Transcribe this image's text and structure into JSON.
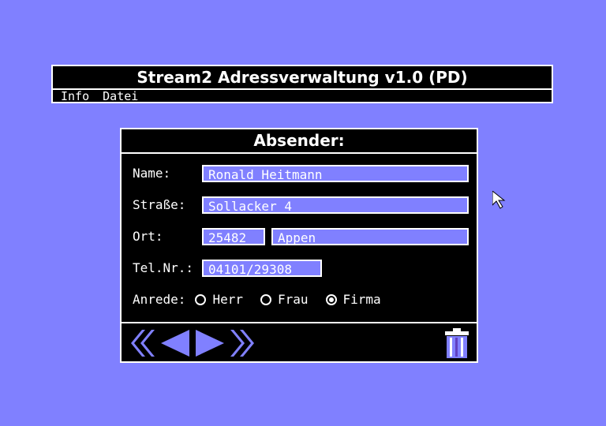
{
  "app": {
    "title": "Stream2 Adressverwaltung v1.0 (PD)",
    "menu": [
      {
        "label": "Info"
      },
      {
        "label": "Datei"
      }
    ]
  },
  "form": {
    "header": "Absender:",
    "name_label": "Name:",
    "name_value": "Ronald Heitmann",
    "street_label": "Straße:",
    "street_value": "Sollacker 4",
    "city_label": "Ort:",
    "zip_value": "25482",
    "city_value": "Appen",
    "phone_label": "Tel.Nr.:",
    "phone_value": "04101/29308",
    "salutation_label": "Anrede:",
    "salutation_options": [
      {
        "label": "Herr",
        "selected": false
      },
      {
        "label": "Frau",
        "selected": false
      },
      {
        "label": "Firma",
        "selected": true
      }
    ]
  },
  "icons": {
    "first": "first-record-icon",
    "prev": "previous-record-icon",
    "next": "next-record-icon",
    "last": "last-record-icon",
    "trash": "trash-icon",
    "cursor": "mouse-pointer-icon"
  },
  "colors": {
    "background": "#8080ff",
    "panel": "#000000",
    "field": "#8080ff",
    "text": "#ffffff"
  }
}
